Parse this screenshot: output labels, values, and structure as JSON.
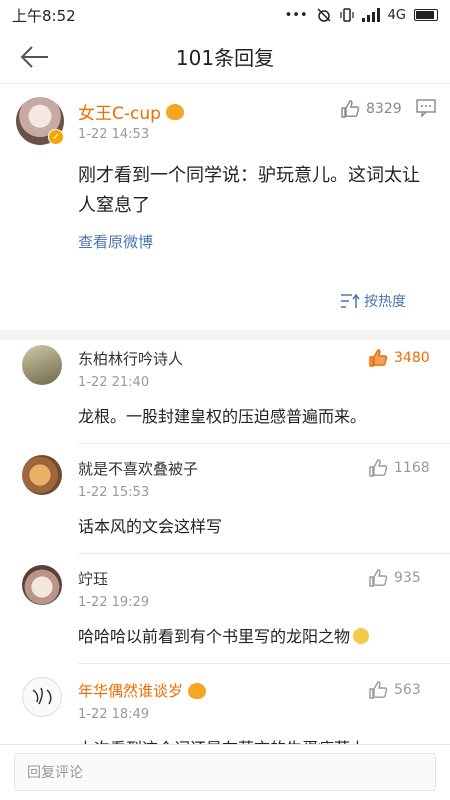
{
  "status_bar": {
    "time": "上午8:52",
    "network": "4G",
    "dots": "•••"
  },
  "nav": {
    "title": "101条回复"
  },
  "op": {
    "name": "女王C-cup",
    "time": "1-22 14:53",
    "likes": "8329",
    "text": "刚才看到一个同学说：驴玩意儿。这词太让人窒息了",
    "link": "查看原微博",
    "sort_label": "按热度"
  },
  "replies": [
    {
      "name": "东柏林行吟诗人",
      "time": "1-22 21:40",
      "likes": "3480",
      "text": "龙根。一股封建皇权的压迫感普遍而来。"
    },
    {
      "name": "就是不喜欢叠被子",
      "time": "1-22 15:53",
      "likes": "1168",
      "text": "话本风的文会这样写"
    },
    {
      "name": "竚珏",
      "time": "1-22 19:29",
      "likes": "935",
      "text": "哈哈哈以前看到有个书里写的龙阳之物"
    },
    {
      "name": "年华偶然谁谈岁",
      "time": "1-22 18:49",
      "likes": "563",
      "text": "上次看到这个词还是在莫言的牛蛋瘦草上"
    }
  ],
  "bottom_bar": {
    "placeholder": "回复评论"
  },
  "colors": {
    "accent_orange": "#f26c00",
    "link_blue": "#4a76b0"
  }
}
